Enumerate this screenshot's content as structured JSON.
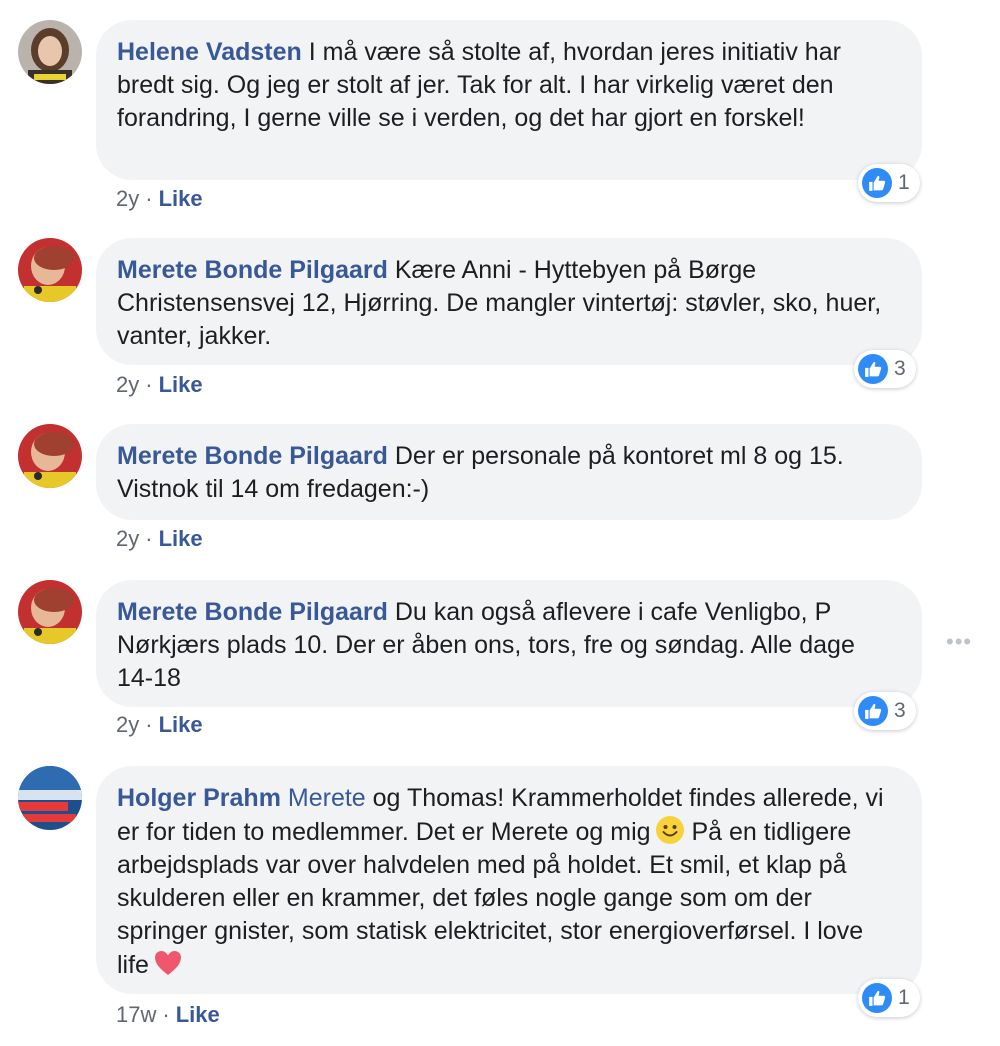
{
  "comments": [
    {
      "author": "Helene Vadsten",
      "text": "I må være så stolte af, hvordan jeres initiativ har bredt sig. Og jeg er stolt af jer. Tak for alt. I har virkelig været den forandring, I gerne ville se i verden, og det har gjort en forskel!",
      "time": "2y",
      "like_label": "Like",
      "reaction_count": "1",
      "avatar_icon": "profile-photo"
    },
    {
      "author": "Merete Bonde Pilgaard",
      "text": "Kære Anni - Hyttebyen på Børge Christensensvej 12, Hjørring. De mangler vintertøj: støvler, sko, huer, vanter, jakker.",
      "time": "2y",
      "like_label": "Like",
      "reaction_count": "3",
      "avatar_icon": "profile-photo"
    },
    {
      "author": "Merete Bonde Pilgaard",
      "text": "Der er personale på kontoret ml 8 og 15. Vistnok til 14 om fredagen:-)",
      "time": "2y",
      "like_label": "Like",
      "avatar_icon": "profile-photo"
    },
    {
      "author": "Merete Bonde Pilgaard",
      "text": "Du kan også aflevere i cafe Venligbo, P Nørkjærs plads 10. Der er åben ons, tors, fre og søndag. Alle dage 14-18",
      "time": "2y",
      "like_label": "Like",
      "reaction_count": "3",
      "avatar_icon": "profile-photo"
    },
    {
      "author": "Holger Prahm",
      "mention": "Merete",
      "text_part1": "og Thomas! Krammerholdet findes allerede, vi er for tiden to medlemmer. Det er Merete og mig",
      "text_part2": "På en tidligere arbejdsplads var over halvdelen med på holdet. Et smil, et klap på skulderen eller en krammer, det føles nogle gange som om der springer gnister, som statisk elektricitet, stor energioverførsel. I love life",
      "time": "17w",
      "like_label": "Like",
      "reaction_count": "1",
      "avatar_icon": "profile-photo",
      "emoji_1": "smiley-emoji",
      "emoji_2": "heart-emoji"
    }
  ],
  "more_options": "•••",
  "colors": {
    "link": "#385898",
    "bubble": "#f2f3f5",
    "like_blue": "#2f8bf5",
    "meta": "#606770"
  }
}
